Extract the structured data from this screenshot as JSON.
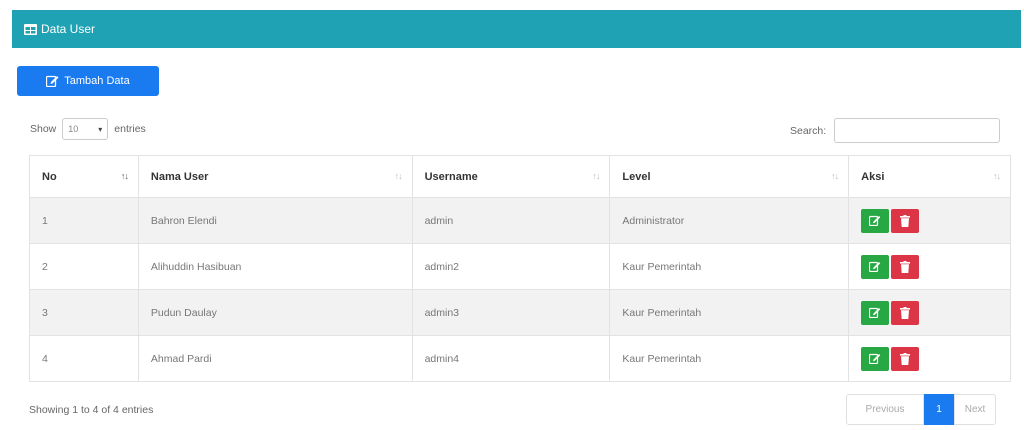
{
  "header": {
    "title": "Data User",
    "icon": "table-icon",
    "color": "#1fa2b4"
  },
  "toolbar": {
    "add_label": "Tambah Data",
    "add_icon": "edit-icon",
    "accent": "#1a7af0"
  },
  "length": {
    "prefix": "Show",
    "value": "10",
    "suffix": "entries"
  },
  "search": {
    "label": "Search:",
    "value": "",
    "placeholder": ""
  },
  "table": {
    "columns": [
      "No",
      "Nama User",
      "Username",
      "Level",
      "Aksi"
    ],
    "rows": [
      {
        "no": "1",
        "nama": "Bahron Elendi",
        "username": "admin",
        "level": "Administrator"
      },
      {
        "no": "2",
        "nama": "Alihuddin Hasibuan",
        "username": "admin2",
        "level": "Kaur Pemerintah"
      },
      {
        "no": "3",
        "nama": "Pudun Daulay",
        "username": "admin3",
        "level": "Kaur Pemerintah"
      },
      {
        "no": "4",
        "nama": "Ahmad Pardi",
        "username": "admin4",
        "level": "Kaur Pemerintah"
      }
    ],
    "action_icons": [
      "edit-icon",
      "trash-icon"
    ],
    "edit_color": "#28a745",
    "delete_color": "#dc3545"
  },
  "footer": {
    "info": "Showing 1 to 4 of 4 entries",
    "pager": {
      "previous": "Previous",
      "current": "1",
      "next": "Next"
    }
  }
}
